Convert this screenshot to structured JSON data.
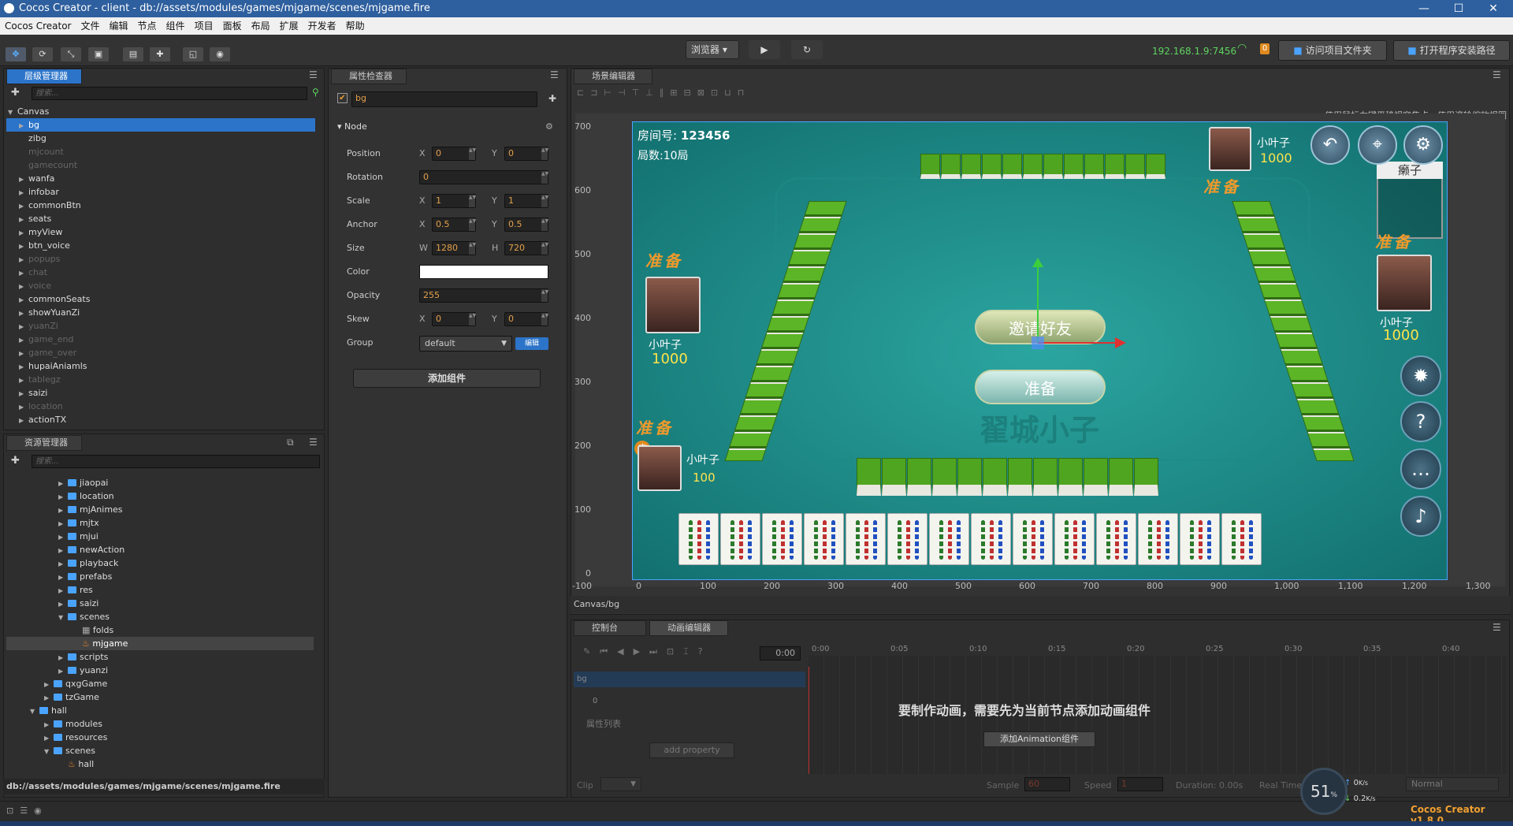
{
  "window": {
    "title": "Cocos Creator - client - db://assets/modules/games/mjgame/scenes/mjgame.fire"
  },
  "menu": [
    "Cocos Creator",
    "文件",
    "编辑",
    "节点",
    "组件",
    "项目",
    "面板",
    "布局",
    "扩展",
    "开发者",
    "帮助"
  ],
  "toolbar": {
    "preview_mode": "浏览器",
    "ip": "192.168.1.9:7456",
    "badge": "0",
    "open_project_folder": "访问项目文件夹",
    "open_install_path": "打开程序安装路径"
  },
  "hierarchy": {
    "title": "层级管理器",
    "search_placeholder": "搜索...",
    "root": "Canvas",
    "items": [
      {
        "label": "bg",
        "arrow": true,
        "dim": false,
        "selected": true
      },
      {
        "label": "zibg",
        "arrow": false,
        "dim": false
      },
      {
        "label": "mjcount",
        "arrow": false,
        "dim": true
      },
      {
        "label": "gamecount",
        "arrow": false,
        "dim": true
      },
      {
        "label": "wanfa",
        "arrow": true,
        "dim": false
      },
      {
        "label": "infobar",
        "arrow": true,
        "dim": false
      },
      {
        "label": "commonBtn",
        "arrow": true,
        "dim": false
      },
      {
        "label": "seats",
        "arrow": true,
        "dim": false
      },
      {
        "label": "myView",
        "arrow": true,
        "dim": false
      },
      {
        "label": "btn_voice",
        "arrow": true,
        "dim": false
      },
      {
        "label": "popups",
        "arrow": true,
        "dim": true
      },
      {
        "label": "chat",
        "arrow": true,
        "dim": true
      },
      {
        "label": "voice",
        "arrow": true,
        "dim": true
      },
      {
        "label": "commonSeats",
        "arrow": true,
        "dim": false
      },
      {
        "label": "showYuanZi",
        "arrow": true,
        "dim": false
      },
      {
        "label": "yuanZi",
        "arrow": true,
        "dim": true
      },
      {
        "label": "game_end",
        "arrow": true,
        "dim": true
      },
      {
        "label": "game_over",
        "arrow": true,
        "dim": true
      },
      {
        "label": "hupaiAniamls",
        "arrow": true,
        "dim": false
      },
      {
        "label": "tablegz",
        "arrow": true,
        "dim": true
      },
      {
        "label": "saizi",
        "arrow": true,
        "dim": false
      },
      {
        "label": "location",
        "arrow": true,
        "dim": true
      },
      {
        "label": "actionTX",
        "arrow": true,
        "dim": false
      }
    ]
  },
  "assets": {
    "title": "资源管理器",
    "search_placeholder": "搜索...",
    "items": [
      {
        "label": "jiaopai",
        "indent": 3,
        "type": "folder",
        "arrow": "right"
      },
      {
        "label": "location",
        "indent": 3,
        "type": "folder",
        "arrow": "right"
      },
      {
        "label": "mjAnimes",
        "indent": 3,
        "type": "folder",
        "arrow": "right"
      },
      {
        "label": "mjtx",
        "indent": 3,
        "type": "folder",
        "arrow": "right"
      },
      {
        "label": "mjui",
        "indent": 3,
        "type": "folder",
        "arrow": "right"
      },
      {
        "label": "newAction",
        "indent": 3,
        "type": "folder",
        "arrow": "right"
      },
      {
        "label": "playback",
        "indent": 3,
        "type": "folder",
        "arrow": "right"
      },
      {
        "label": "prefabs",
        "indent": 3,
        "type": "folder",
        "arrow": "right"
      },
      {
        "label": "res",
        "indent": 3,
        "type": "folder",
        "arrow": "right"
      },
      {
        "label": "saizi",
        "indent": 3,
        "type": "folder",
        "arrow": "right"
      },
      {
        "label": "scenes",
        "indent": 3,
        "type": "folder",
        "arrow": "down"
      },
      {
        "label": "folds",
        "indent": 4,
        "type": "file",
        "arrow": "none"
      },
      {
        "label": "mjgame",
        "indent": 4,
        "type": "fire",
        "arrow": "none",
        "selected": true
      },
      {
        "label": "scripts",
        "indent": 3,
        "type": "folder",
        "arrow": "right"
      },
      {
        "label": "yuanzi",
        "indent": 3,
        "type": "folder",
        "arrow": "right"
      },
      {
        "label": "qxgGame",
        "indent": 2,
        "type": "folder",
        "arrow": "right"
      },
      {
        "label": "tzGame",
        "indent": 2,
        "type": "folder",
        "arrow": "right"
      },
      {
        "label": "hall",
        "indent": 1,
        "type": "folder",
        "arrow": "down"
      },
      {
        "label": "modules",
        "indent": 2,
        "type": "folder",
        "arrow": "right"
      },
      {
        "label": "resources",
        "indent": 2,
        "type": "folder",
        "arrow": "right"
      },
      {
        "label": "scenes",
        "indent": 2,
        "type": "folder",
        "arrow": "down"
      },
      {
        "label": "hall",
        "indent": 3,
        "type": "fire",
        "arrow": "none"
      }
    ],
    "path": "db://assets/modules/games/mjgame/scenes/mjgame.fire"
  },
  "inspector": {
    "title": "属性检查器",
    "node_name": "bg",
    "section": "Node",
    "position": {
      "x": "0",
      "y": "0"
    },
    "rotation": "0",
    "scale": {
      "x": "1",
      "y": "1"
    },
    "anchor": {
      "x": "0.5",
      "y": "0.5"
    },
    "size": {
      "w": "1280",
      "h": "720"
    },
    "color_hex": "#ffffff",
    "opacity": "255",
    "skew": {
      "x": "0",
      "y": "0"
    },
    "group": "default",
    "edit_btn": "编辑",
    "add_component": "添加组件",
    "labels": {
      "position": "Position",
      "rotation": "Rotation",
      "scale": "Scale",
      "anchor": "Anchor",
      "size": "Size",
      "color": "Color",
      "opacity": "Opacity",
      "skew": "Skew",
      "group": "Group",
      "x": "X",
      "y": "Y",
      "w": "W",
      "h": "H"
    }
  },
  "scene": {
    "title": "场景编辑器",
    "hint": "使用鼠标右键平移视窗焦点，使用滚轮缩放视图",
    "ruler_y": [
      "700",
      "600",
      "500",
      "400",
      "300",
      "200",
      "100",
      "0"
    ],
    "ruler_x": [
      "-100",
      "0",
      "100",
      "200",
      "300",
      "400",
      "500",
      "600",
      "700",
      "800",
      "900",
      "1,000",
      "1,100",
      "1,200",
      "1,300"
    ],
    "breadcrumb": "Canvas/bg",
    "game": {
      "room_label": "房间号:",
      "room_no": "123456",
      "rounds": "局数:10局",
      "ready": "准备",
      "player_name": "小叶子",
      "score_top": "1000",
      "score_left": "1000",
      "score_right": "1000",
      "score_bottom": "100",
      "banker": "庄",
      "laizi": "癞子",
      "invite": "邀请好友",
      "ready_btn": "准备",
      "watermark": "翟城小子"
    }
  },
  "console_tab": "控制台",
  "anim": {
    "title": "动画编辑器",
    "time": "0:00",
    "ticks": [
      "0:00",
      "0:05",
      "0:10",
      "0:15",
      "0:20",
      "0:25",
      "0:30",
      "0:35",
      "0:40"
    ],
    "node": "bg",
    "zero": "0",
    "prop_list": "属性列表",
    "message": "要制作动画，需要先为当前节点添加动画组件",
    "add_property": "add property",
    "add_anim": "添加Animation组件",
    "clip_label": "Clip",
    "sample_label": "Sample",
    "sample": "60",
    "speed_label": "Speed",
    "speed": "1",
    "duration": "Duration: 0.00s",
    "realtime": "Real Time",
    "wrap": "Normal"
  },
  "status": {
    "version": "Cocos Creator v1.8.0",
    "cpu": "51",
    "cpu_unit": "%",
    "up": "0",
    "up_unit": "K/s",
    "down": "0.2",
    "down_unit": "K/s"
  }
}
